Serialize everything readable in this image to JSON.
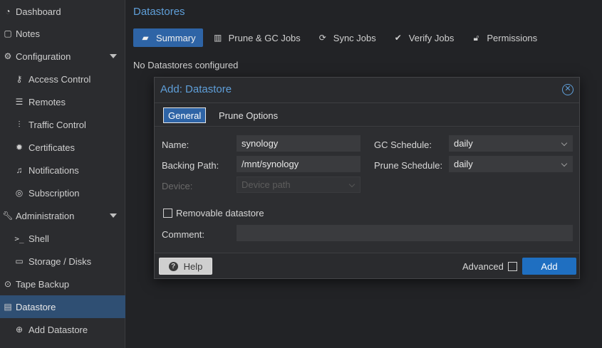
{
  "sidebar": {
    "items": [
      {
        "label": "Dashboard",
        "icon": "dashboard-icon"
      },
      {
        "label": "Notes",
        "icon": "notes-icon"
      },
      {
        "label": "Configuration",
        "icon": "gears-icon"
      },
      {
        "label": "Access Control",
        "icon": "key-icon"
      },
      {
        "label": "Remotes",
        "icon": "server-icon"
      },
      {
        "label": "Traffic Control",
        "icon": "chart-icon"
      },
      {
        "label": "Certificates",
        "icon": "certificate-icon"
      },
      {
        "label": "Notifications",
        "icon": "bell-icon"
      },
      {
        "label": "Subscription",
        "icon": "support-icon"
      },
      {
        "label": "Administration",
        "icon": "wrench-icon"
      },
      {
        "label": "Shell",
        "icon": "terminal-icon"
      },
      {
        "label": "Storage / Disks",
        "icon": "hdd-icon"
      },
      {
        "label": "Tape Backup",
        "icon": "tape-icon"
      },
      {
        "label": "Datastore",
        "icon": "archive-icon"
      },
      {
        "label": "Add Datastore",
        "icon": "plus-circle-icon"
      }
    ]
  },
  "main": {
    "title": "Datastores",
    "tabs": [
      {
        "label": "Summary",
        "icon": "book-icon"
      },
      {
        "label": "Prune & GC Jobs",
        "icon": "trash-icon"
      },
      {
        "label": "Sync Jobs",
        "icon": "refresh-icon"
      },
      {
        "label": "Verify Jobs",
        "icon": "check-circle-icon"
      },
      {
        "label": "Permissions",
        "icon": "unlock-icon"
      }
    ],
    "empty_message": "No Datastores configured"
  },
  "dialog": {
    "title": "Add: Datastore",
    "tabs": [
      {
        "label": "General"
      },
      {
        "label": "Prune Options"
      }
    ],
    "form": {
      "name_label": "Name:",
      "name_value": "synology",
      "backing_path_label": "Backing Path:",
      "backing_path_value": "/mnt/synology",
      "device_label": "Device:",
      "device_placeholder": "Device path",
      "gc_schedule_label": "GC Schedule:",
      "gc_schedule_value": "daily",
      "prune_schedule_label": "Prune Schedule:",
      "prune_schedule_value": "daily",
      "removable_label": "Removable datastore",
      "comment_label": "Comment:",
      "comment_value": ""
    },
    "footer": {
      "help_label": "Help",
      "advanced_label": "Advanced",
      "add_label": "Add"
    }
  },
  "colors": {
    "accent": "#5f9fd9",
    "active_tab": "#2e64a6",
    "primary_button": "#1f6fc1",
    "sidebar_active": "#2f4f73"
  }
}
